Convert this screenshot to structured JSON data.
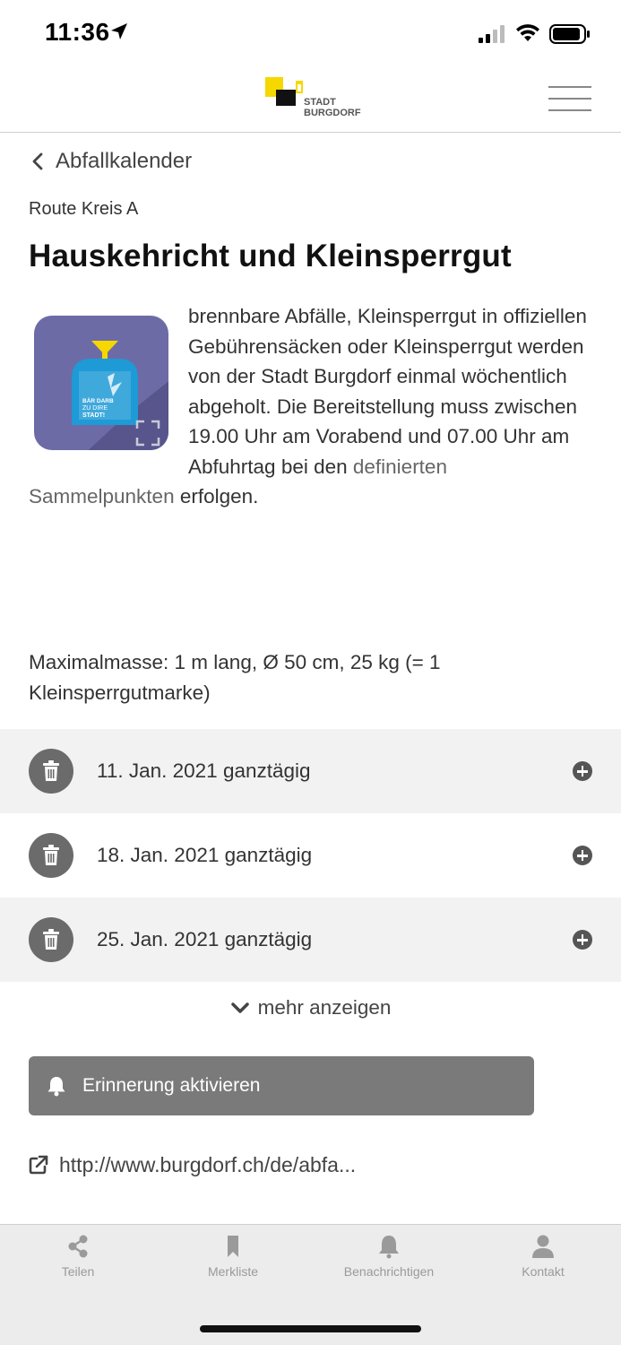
{
  "status_bar": {
    "time": "11:36",
    "icons": [
      "location-arrow-icon",
      "cellular-signal-icon",
      "wifi-icon",
      "battery-icon"
    ]
  },
  "header": {
    "logo_line1": "STADT",
    "logo_line2": "BURGDORF",
    "logo_colors": {
      "yellow": "#f5d800",
      "black": "#111111"
    },
    "menu_icon": "hamburger-menu-icon"
  },
  "back": {
    "label": "Abfallkalender"
  },
  "route": "Route Kreis A",
  "title": "Hauskehricht und Kleinsperrgut",
  "thumbnail": {
    "bag_text_line1": "BÄR DARB",
    "bag_text_line2": "ZU DIRE",
    "bag_text_line3": "STADT!",
    "icons": [
      "expand-icon"
    ]
  },
  "description": {
    "text_before_link": "brennbare Abfälle, Kleinsperrgut in offiziellen Gebührensäcken oder Kleinsperrgut werden von der Stadt Burgdorf einmal wöchentlich abgeholt. Die Bereitstellung muss zwischen 19.00 Uhr am Vorabend und 07.00 Uhr am Abfuhrtag bei den ",
    "link_text": "definierten Sammelpunkten",
    "text_after_link": " erfolgen."
  },
  "max_dimensions": "Maximalmasse: 1 m lang, Ø 50 cm, 25 kg (= 1 Kleinsperrgutmarke)",
  "dates": [
    {
      "label": "11. Jan. 2021 ganztägig"
    },
    {
      "label": "18. Jan. 2021 ganztägig"
    },
    {
      "label": "25. Jan. 2021 ganztägig"
    }
  ],
  "more": {
    "label": "mehr anzeigen"
  },
  "reminder": {
    "label": "Erinnerung aktivieren"
  },
  "external_link": {
    "label": "http://www.burgdorf.ch/de/abfa..."
  },
  "tabbar": {
    "items": [
      {
        "label": "Teilen",
        "icon": "share-icon"
      },
      {
        "label": "Merkliste",
        "icon": "bookmark-icon"
      },
      {
        "label": "Benachrichtigen",
        "icon": "bell-icon"
      },
      {
        "label": "Kontakt",
        "icon": "person-icon"
      }
    ]
  }
}
